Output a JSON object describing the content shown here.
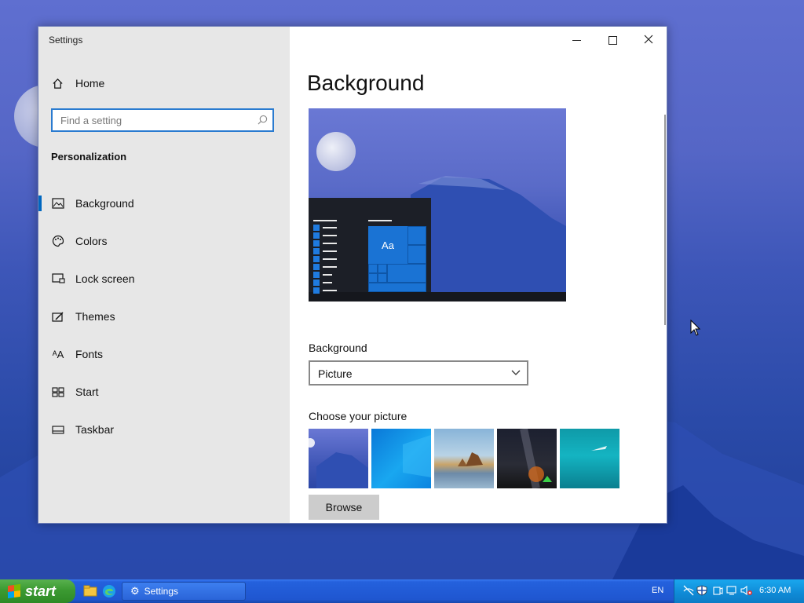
{
  "window": {
    "title": "Settings",
    "controls": {
      "minimize": "—",
      "maximize": "☐",
      "close": "✕"
    }
  },
  "sidebar": {
    "home_label": "Home",
    "search_placeholder": "Find a setting",
    "section_title": "Personalization",
    "items": [
      {
        "label": "Background",
        "icon": "picture-icon",
        "selected": true
      },
      {
        "label": "Colors",
        "icon": "palette-icon",
        "selected": false
      },
      {
        "label": "Lock screen",
        "icon": "lock-screen-icon",
        "selected": false
      },
      {
        "label": "Themes",
        "icon": "brush-icon",
        "selected": false
      },
      {
        "label": "Fonts",
        "icon": "font-icon",
        "selected": false
      },
      {
        "label": "Start",
        "icon": "start-icon",
        "selected": false
      },
      {
        "label": "Taskbar",
        "icon": "taskbar-icon",
        "selected": false
      }
    ]
  },
  "main": {
    "title": "Background",
    "preview_tile_label": "Aa",
    "background_label": "Background",
    "background_value": "Picture",
    "choose_label": "Choose your picture",
    "browse_label": "Browse"
  },
  "taskbar": {
    "start_label": "start",
    "task_button_label": "Settings",
    "language": "EN",
    "clock": "6:30 AM"
  },
  "colors": {
    "accent": "#0067c0",
    "taskbar": "#1f56d0",
    "start_green": "#3c9a32"
  }
}
